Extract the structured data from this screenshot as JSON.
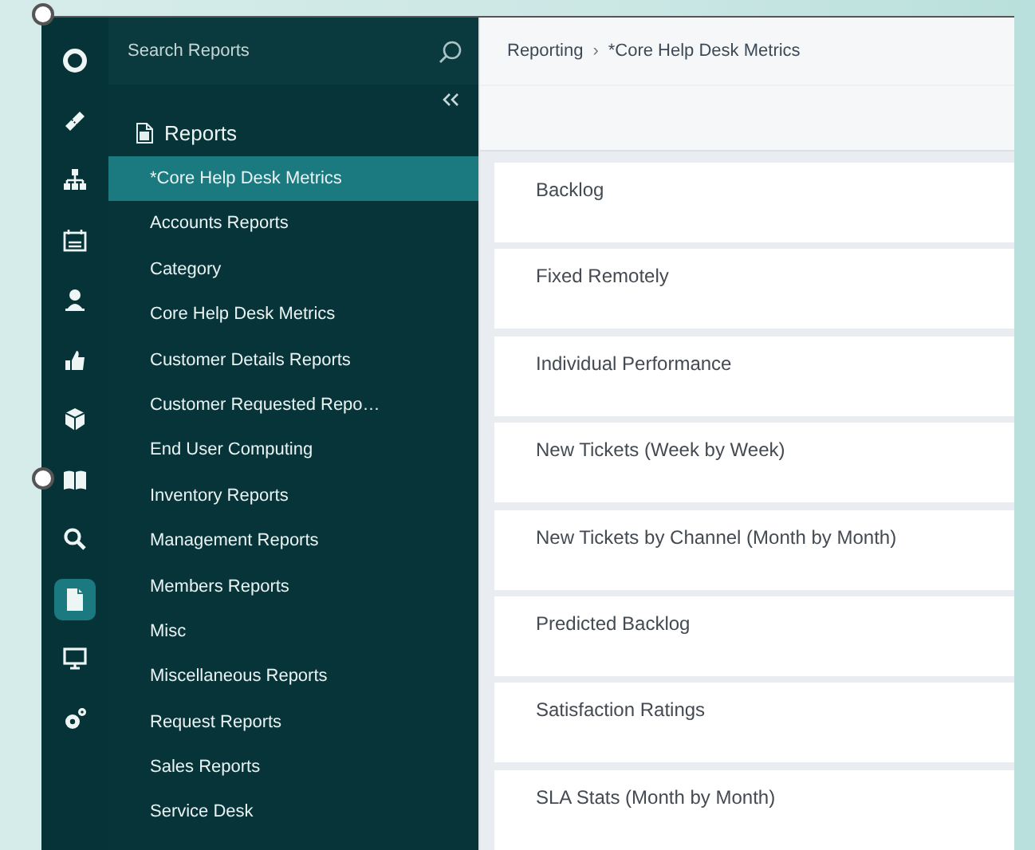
{
  "rail": [
    {
      "kind": "logo",
      "selected": false
    },
    {
      "kind": "ticket",
      "selected": false
    },
    {
      "kind": "hierarchy",
      "selected": false
    },
    {
      "kind": "calendar",
      "selected": false
    },
    {
      "kind": "person",
      "selected": false
    },
    {
      "kind": "thumb",
      "selected": false
    },
    {
      "kind": "box",
      "selected": false
    },
    {
      "kind": "book",
      "selected": false
    },
    {
      "kind": "search",
      "selected": false
    },
    {
      "kind": "document",
      "selected": true
    },
    {
      "kind": "monitor",
      "selected": false
    },
    {
      "kind": "gears",
      "selected": false
    }
  ],
  "sidebar": {
    "search": {
      "placeholder": "Search Reports"
    },
    "heading": "Reports",
    "items": [
      {
        "label": "*Core Help Desk Metrics",
        "selected": true
      },
      {
        "label": "Accounts Reports",
        "selected": false
      },
      {
        "label": "Category",
        "selected": false
      },
      {
        "label": "Core Help Desk Metrics",
        "selected": false
      },
      {
        "label": "Customer Details Reports",
        "selected": false
      },
      {
        "label": "Customer Requested Repo…",
        "selected": false
      },
      {
        "label": "End User Computing",
        "selected": false
      },
      {
        "label": "Inventory Reports",
        "selected": false
      },
      {
        "label": "Management Reports",
        "selected": false
      },
      {
        "label": "Members Reports",
        "selected": false
      },
      {
        "label": "Misc",
        "selected": false
      },
      {
        "label": "Miscellaneous Reports",
        "selected": false
      },
      {
        "label": "Request Reports",
        "selected": false
      },
      {
        "label": "Sales Reports",
        "selected": false
      },
      {
        "label": "Service Desk",
        "selected": false
      }
    ]
  },
  "breadcrumb": {
    "items": [
      "Reporting",
      "*Core Help Desk Metrics"
    ],
    "separator": "›"
  },
  "reports": [
    "Backlog",
    "Fixed Remotely",
    "Individual Performance",
    "New Tickets (Week by Week)",
    "New Tickets by Channel (Month by Month)",
    "Predicted Backlog",
    "Satisfaction Ratings",
    "SLA Stats (Month by Month)"
  ]
}
